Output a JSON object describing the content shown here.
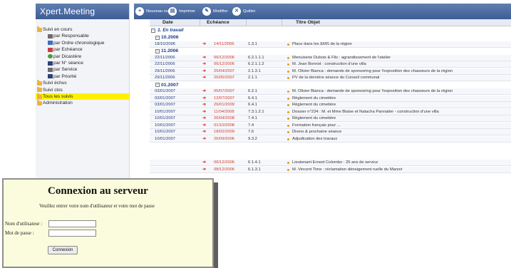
{
  "app": {
    "title": "Xpert.Meeting"
  },
  "toolbar": {
    "buttons": [
      {
        "label": "Nouveau suivi",
        "icon": "new-icon"
      },
      {
        "label": "Imprimer",
        "icon": "print-icon"
      },
      {
        "label": "Modifier",
        "icon": "edit-icon"
      },
      {
        "label": "Quitter",
        "icon": "quit-icon"
      }
    ]
  },
  "sidebar": {
    "items": [
      {
        "label": "Suivi en cours",
        "icon": "folder-icon",
        "level": 0
      },
      {
        "label": "par Responsable",
        "icon": "person-icon",
        "level": 1
      },
      {
        "label": "par Ordre chronologique",
        "icon": "calendar-icon",
        "level": 1
      },
      {
        "label": "par Echéance",
        "icon": "calendar-icon",
        "level": 1
      },
      {
        "label": "par Dicastère",
        "icon": "globe-icon",
        "level": 1
      },
      {
        "label": "par N° séance",
        "icon": "number-icon",
        "level": 1
      },
      {
        "label": "par Service",
        "icon": "building-icon",
        "level": 1
      },
      {
        "label": "par Priorité",
        "icon": "priority-icon",
        "level": 1
      },
      {
        "label": "Suivi échus",
        "icon": "folder-icon",
        "level": 0
      },
      {
        "label": "Suivi clos",
        "icon": "folder-icon",
        "level": 0
      },
      {
        "label": "Tous les suivis",
        "icon": "folder-icon",
        "level": 0,
        "selected": true
      },
      {
        "label": "Administration",
        "icon": "folder-icon",
        "level": 0
      }
    ]
  },
  "table": {
    "headers": {
      "date": "Date",
      "echeance": "Echéance",
      "titre": "Titre Objet"
    },
    "section": {
      "label": "1. En travail",
      "expander": "−"
    },
    "groups": [
      {
        "month": "10.2006",
        "rows": [
          {
            "date": "18/10/2006",
            "echeance": "14/11/2006",
            "num": "1.3.1",
            "title": "Place dans les EMS de la région"
          }
        ]
      },
      {
        "month": "11.2006",
        "rows": [
          {
            "date": "22/11/2006",
            "echeance": "06/12/2006",
            "num": "6.2.1.1.1",
            "title": "Menuiserie Dubois & Fils : agrandissement de l'atelier"
          },
          {
            "date": "22/11/2006",
            "echeance": "06/12/2006",
            "num": "6.2.1.1.2",
            "title": "M. Jean Bonnot : construction d'une villa"
          },
          {
            "date": "29/11/2006",
            "echeance": "25/04/2007",
            "num": "2.1.3.1",
            "title": "M. Olivier Bianca : demande de sponsoring pour l'exposition des chasseurs de la région"
          },
          {
            "date": "29/11/2006",
            "echeance": "26/05/2007",
            "num": "2.1.1",
            "title": "PV de la dernière séance du Conseil communal"
          }
        ]
      },
      {
        "month": "01.2007",
        "rows": [
          {
            "date": "03/01/2007",
            "echeance": "05/07/2007",
            "num": "6.2.1",
            "title": "M. Olivier Bianca : demande de sponsoring pour l'exposition des chasseurs de la région"
          },
          {
            "date": "03/01/2007",
            "echeance": "12/07/2007",
            "num": "6.4.1",
            "title": "Règlement du cimetière"
          },
          {
            "date": "03/01/2007",
            "echeance": "26/01/2009",
            "num": "6.4.1",
            "title": "Règlement du cimetière"
          },
          {
            "date": "10/01/2007",
            "echeance": "11/04/2008",
            "num": "7.3.1.2.1",
            "title": "Dossier n°234 : M. et Mme Blaise et Natacha Pannatier - construction d'une villa"
          },
          {
            "date": "10/01/2007",
            "echeance": "26/04/2008",
            "num": "7.4.1",
            "title": "Règlement du cimetière"
          },
          {
            "date": "10/01/2007",
            "echeance": "01/10/2008",
            "num": "7.4",
            "title": "Formation français pour ..."
          },
          {
            "date": "10/01/2007",
            "echeance": "18/02/2009",
            "num": "7.6",
            "title": "Divers & prochaine séance"
          },
          {
            "date": "10/01/2007",
            "echeance": "26/09/2006",
            "num": "9.3.2",
            "title": "Adjudication des travaux"
          }
        ]
      },
      {
        "month": "",
        "rows": [
          {
            "date": "",
            "echeance": "06/12/2006",
            "num": "6.1.4.1",
            "title": "Lieutenant Ernest Colombo : 25 ans de service"
          },
          {
            "date": "",
            "echeance": "08/12/2006",
            "num": "6.1.3.1",
            "title": "M. Vincent Time : réclamation déneigement ruelle du Manoir"
          }
        ]
      }
    ]
  },
  "dialog": {
    "title": "Connexion au serveur",
    "subtitle": "Veuillez entrer votre nom d'utilisateur et votre mot de passe",
    "username_label": "Nom d'utilisateur :",
    "password_label": "Mot de passe :",
    "username_value": "",
    "password_value": "",
    "button_label": "Connexion"
  },
  "colors": {
    "header_blue": "#3e5d94",
    "selected_yellow": "#fff200",
    "dialog_bg": "#fbfbdd",
    "echeance_red": "#d23a2a"
  }
}
